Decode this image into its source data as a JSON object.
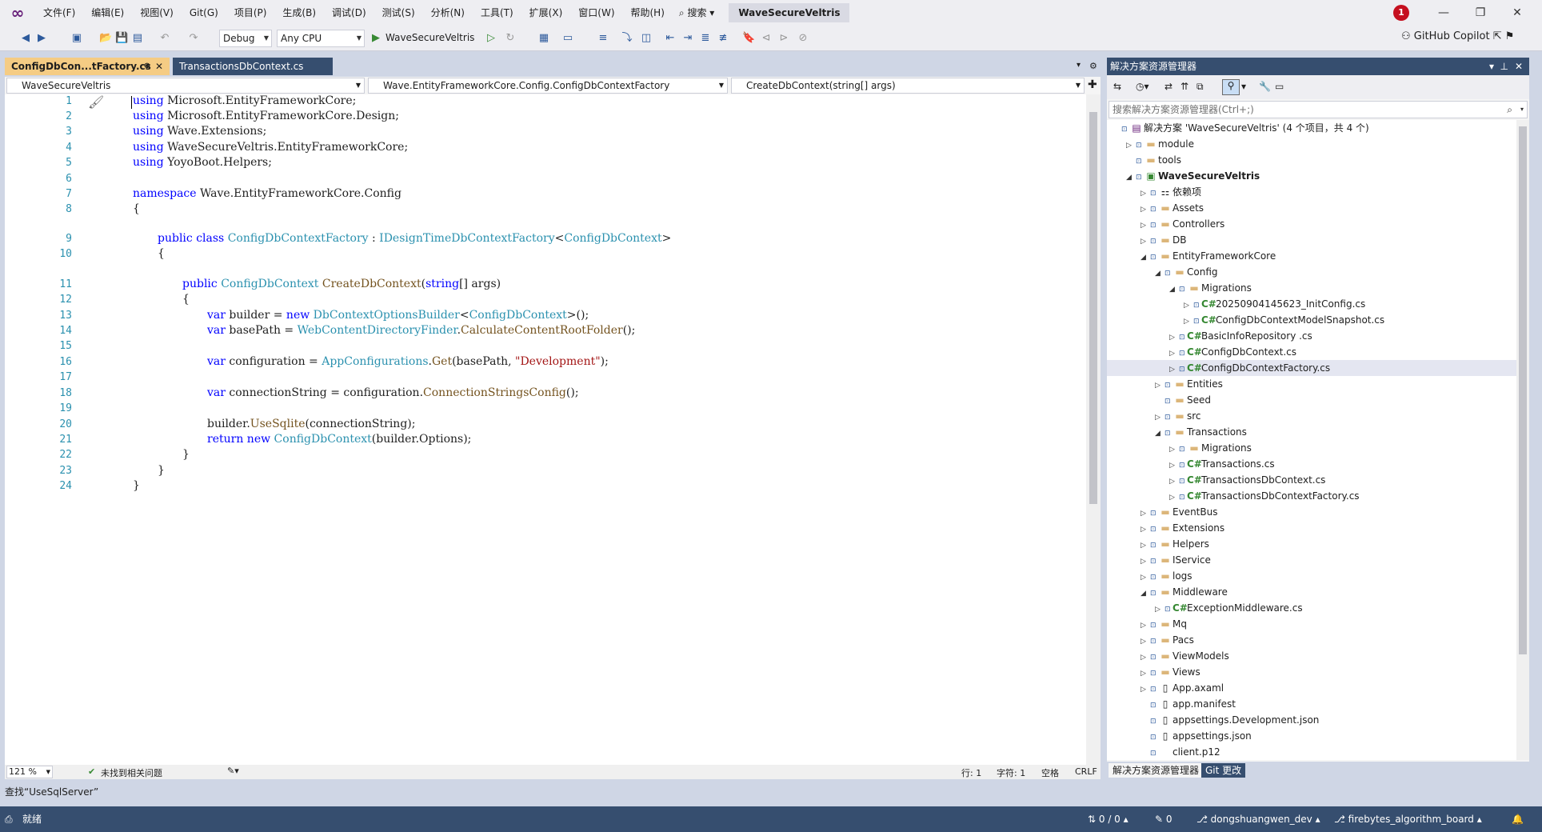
{
  "titlebar": {
    "menu": [
      "文件(F)",
      "编辑(E)",
      "视图(V)",
      "Git(G)",
      "项目(P)",
      "生成(B)",
      "调试(D)",
      "测试(S)",
      "分析(N)",
      "工具(T)",
      "扩展(X)",
      "窗口(W)",
      "帮助(H)"
    ],
    "search_label": "搜索",
    "solution_name": "WaveSecureVeltris",
    "notification_count": "1",
    "accent": "#68217a"
  },
  "toolbar": {
    "config": "Debug",
    "platform": "Any CPU",
    "start_target": "WaveSecureVeltris",
    "copilot_label": "GitHub Copilot"
  },
  "tabs": {
    "active": "ConfigDbCon...tFactory.cs",
    "inactive": "TransactionsDbContext.cs"
  },
  "navbar": {
    "project": "WaveSecureVeltris",
    "class": "Wave.EntityFrameworkCore.Config.ConfigDbContextFactory",
    "member": "CreateDbContext(string[] args)"
  },
  "code": {
    "line_numbers": [
      "1",
      "2",
      "3",
      "4",
      "5",
      "6",
      "7",
      "8",
      "9",
      "10",
      "11",
      "12",
      "13",
      "14",
      "15",
      "16",
      "17",
      "18",
      "19",
      "20",
      "21",
      "22",
      "23",
      "24"
    ],
    "l1_kw": "using",
    "l1_ns": " Microsoft.EntityFrameworkCore;",
    "l2_kw": "using",
    "l2_ns": " Microsoft.EntityFrameworkCore.Design;",
    "l3_kw": "using",
    "l3_ns": " Wave.Extensions;",
    "l4_kw": "using",
    "l4_ns": " WaveSecureVeltris.EntityFrameworkCore;",
    "l5_kw": "using",
    "l5_ns": " YoyoBoot.Helpers;",
    "l7_kw": "namespace",
    "l7_ns": " Wave.EntityFrameworkCore.Config",
    "l8": "{",
    "l9_kw1": "public",
    "l9_kw2": "class",
    "l9_ty1": "ConfigDbContextFactory",
    "l9_sep": " : ",
    "l9_ty2": "IDesignTimeDbContextFactory",
    "l9_lt": "<",
    "l9_ty3": "ConfigDbContext",
    "l9_gt": ">",
    "l10": "{",
    "l11_kw": "public",
    "l11_ty": "ConfigDbContext",
    "l11_fn": "CreateDbContext",
    "l11_p1": "(",
    "l11_kw2": "string",
    "l11_p2": "[] args)",
    "l12": "{",
    "l13_kw": "var",
    "l13_a": " builder = ",
    "l13_kw2": "new",
    "l13_ty": "DbContextOptionsBuilder",
    "l13_lt": "<",
    "l13_ty2": "ConfigDbContext",
    "l13_b": ">();",
    "l14_kw": "var",
    "l14_a": " basePath = ",
    "l14_ty": "WebContentDirectoryFinder",
    "l14_dot": ".",
    "l14_fn": "CalculateContentRootFolder",
    "l14_b": "();",
    "l16_kw": "var",
    "l16_a": " configuration = ",
    "l16_ty": "AppConfigurations",
    "l16_dot": ".",
    "l16_fn": "Get",
    "l16_b": "(basePath, ",
    "l16_str": "\"Development\"",
    "l16_c": ");",
    "l18_kw": "var",
    "l18_a": " connectionString = configuration.",
    "l18_fn": "ConnectionStringsConfig",
    "l18_b": "();",
    "l20_a": "builder.",
    "l20_fn": "UseSqlite",
    "l20_b": "(connectionString);",
    "l21_kw": "return",
    "l21_kw2": "new",
    "l21_ty": "ConfigDbContext",
    "l21_b": "(builder.Options);",
    "l22": "}",
    "l23": "}",
    "l24": "}"
  },
  "editor_status": {
    "zoom": "121 %",
    "issues": "未找到相关问题",
    "line": "行: 1",
    "char": "字符: 1",
    "space": "空格",
    "eol": "CRLF"
  },
  "findbar": "查找“UseSqlServer”",
  "solution_explorer": {
    "title": "解决方案资源管理器",
    "search_placeholder": "搜索解决方案资源管理器(Ctrl+;)",
    "tree": [
      {
        "label": "解决方案 'WaveSecureVeltris' (4 个项目，共 4 个)",
        "indent": 0,
        "exp": "",
        "icon": "sln"
      },
      {
        "label": "module",
        "indent": 1,
        "exp": "▷",
        "icon": "folder"
      },
      {
        "label": "tools",
        "indent": 1,
        "exp": "",
        "icon": "folder"
      },
      {
        "label": "WaveSecureVeltris",
        "indent": 1,
        "exp": "◢",
        "icon": "proj",
        "bold": true
      },
      {
        "label": "依赖项",
        "indent": 2,
        "exp": "▷",
        "icon": "deps"
      },
      {
        "label": "Assets",
        "indent": 2,
        "exp": "▷",
        "icon": "folder"
      },
      {
        "label": "Controllers",
        "indent": 2,
        "exp": "▷",
        "icon": "folder"
      },
      {
        "label": "DB",
        "indent": 2,
        "exp": "▷",
        "icon": "folder"
      },
      {
        "label": "EntityFrameworkCore",
        "indent": 2,
        "exp": "◢",
        "icon": "folder"
      },
      {
        "label": "Config",
        "indent": 3,
        "exp": "◢",
        "icon": "folder"
      },
      {
        "label": "Migrations",
        "indent": 4,
        "exp": "◢",
        "icon": "folder"
      },
      {
        "label": "20250904145623_InitConfig.cs",
        "indent": 5,
        "exp": "▷",
        "icon": "cs"
      },
      {
        "label": "ConfigDbContextModelSnapshot.cs",
        "indent": 5,
        "exp": "▷",
        "icon": "cs"
      },
      {
        "label": "BasicInfoRepository .cs",
        "indent": 4,
        "exp": "▷",
        "icon": "cs"
      },
      {
        "label": "ConfigDbContext.cs",
        "indent": 4,
        "exp": "▷",
        "icon": "cs"
      },
      {
        "label": "ConfigDbContextFactory.cs",
        "indent": 4,
        "exp": "▷",
        "icon": "cs",
        "sel": true
      },
      {
        "label": "Entities",
        "indent": 3,
        "exp": "▷",
        "icon": "folder"
      },
      {
        "label": "Seed",
        "indent": 3,
        "exp": "",
        "icon": "folder-x"
      },
      {
        "label": "src",
        "indent": 3,
        "exp": "▷",
        "icon": "folder"
      },
      {
        "label": "Transactions",
        "indent": 3,
        "exp": "◢",
        "icon": "folder"
      },
      {
        "label": "Migrations",
        "indent": 4,
        "exp": "▷",
        "icon": "folder"
      },
      {
        "label": "Transactions.cs",
        "indent": 4,
        "exp": "▷",
        "icon": "cs"
      },
      {
        "label": "TransactionsDbContext.cs",
        "indent": 4,
        "exp": "▷",
        "icon": "cs"
      },
      {
        "label": "TransactionsDbContextFactory.cs",
        "indent": 4,
        "exp": "▷",
        "icon": "cs"
      },
      {
        "label": "EventBus",
        "indent": 2,
        "exp": "▷",
        "icon": "folder"
      },
      {
        "label": "Extensions",
        "indent": 2,
        "exp": "▷",
        "icon": "folder"
      },
      {
        "label": "Helpers",
        "indent": 2,
        "exp": "▷",
        "icon": "folder"
      },
      {
        "label": "IService",
        "indent": 2,
        "exp": "▷",
        "icon": "folder"
      },
      {
        "label": "logs",
        "indent": 2,
        "exp": "▷",
        "icon": "folder"
      },
      {
        "label": "Middleware",
        "indent": 2,
        "exp": "◢",
        "icon": "folder"
      },
      {
        "label": "ExceptionMiddleware.cs",
        "indent": 3,
        "exp": "▷",
        "icon": "cs"
      },
      {
        "label": "Mq",
        "indent": 2,
        "exp": "▷",
        "icon": "folder-x"
      },
      {
        "label": "Pacs",
        "indent": 2,
        "exp": "▷",
        "icon": "folder-x"
      },
      {
        "label": "ViewModels",
        "indent": 2,
        "exp": "▷",
        "icon": "folder"
      },
      {
        "label": "Views",
        "indent": 2,
        "exp": "▷",
        "icon": "folder"
      },
      {
        "label": "App.axaml",
        "indent": 2,
        "exp": "▷",
        "icon": "file"
      },
      {
        "label": "app.manifest",
        "indent": 2,
        "exp": "",
        "icon": "file"
      },
      {
        "label": "appsettings.Development.json",
        "indent": 2,
        "exp": "",
        "icon": "file"
      },
      {
        "label": "appsettings.json",
        "indent": 2,
        "exp": "",
        "icon": "file"
      },
      {
        "label": "client.p12",
        "indent": 2,
        "exp": "",
        "icon": "none"
      }
    ],
    "tab_active": "解决方案资源管理器",
    "tab_git": "Git 更改"
  },
  "statusbar": {
    "ready": "就绪",
    "updown": "0 / 0",
    "pencil": "0",
    "user": "dongshuangwen_dev",
    "branch": "firebytes_algorithm_board",
    "bg": "#364e6f"
  }
}
